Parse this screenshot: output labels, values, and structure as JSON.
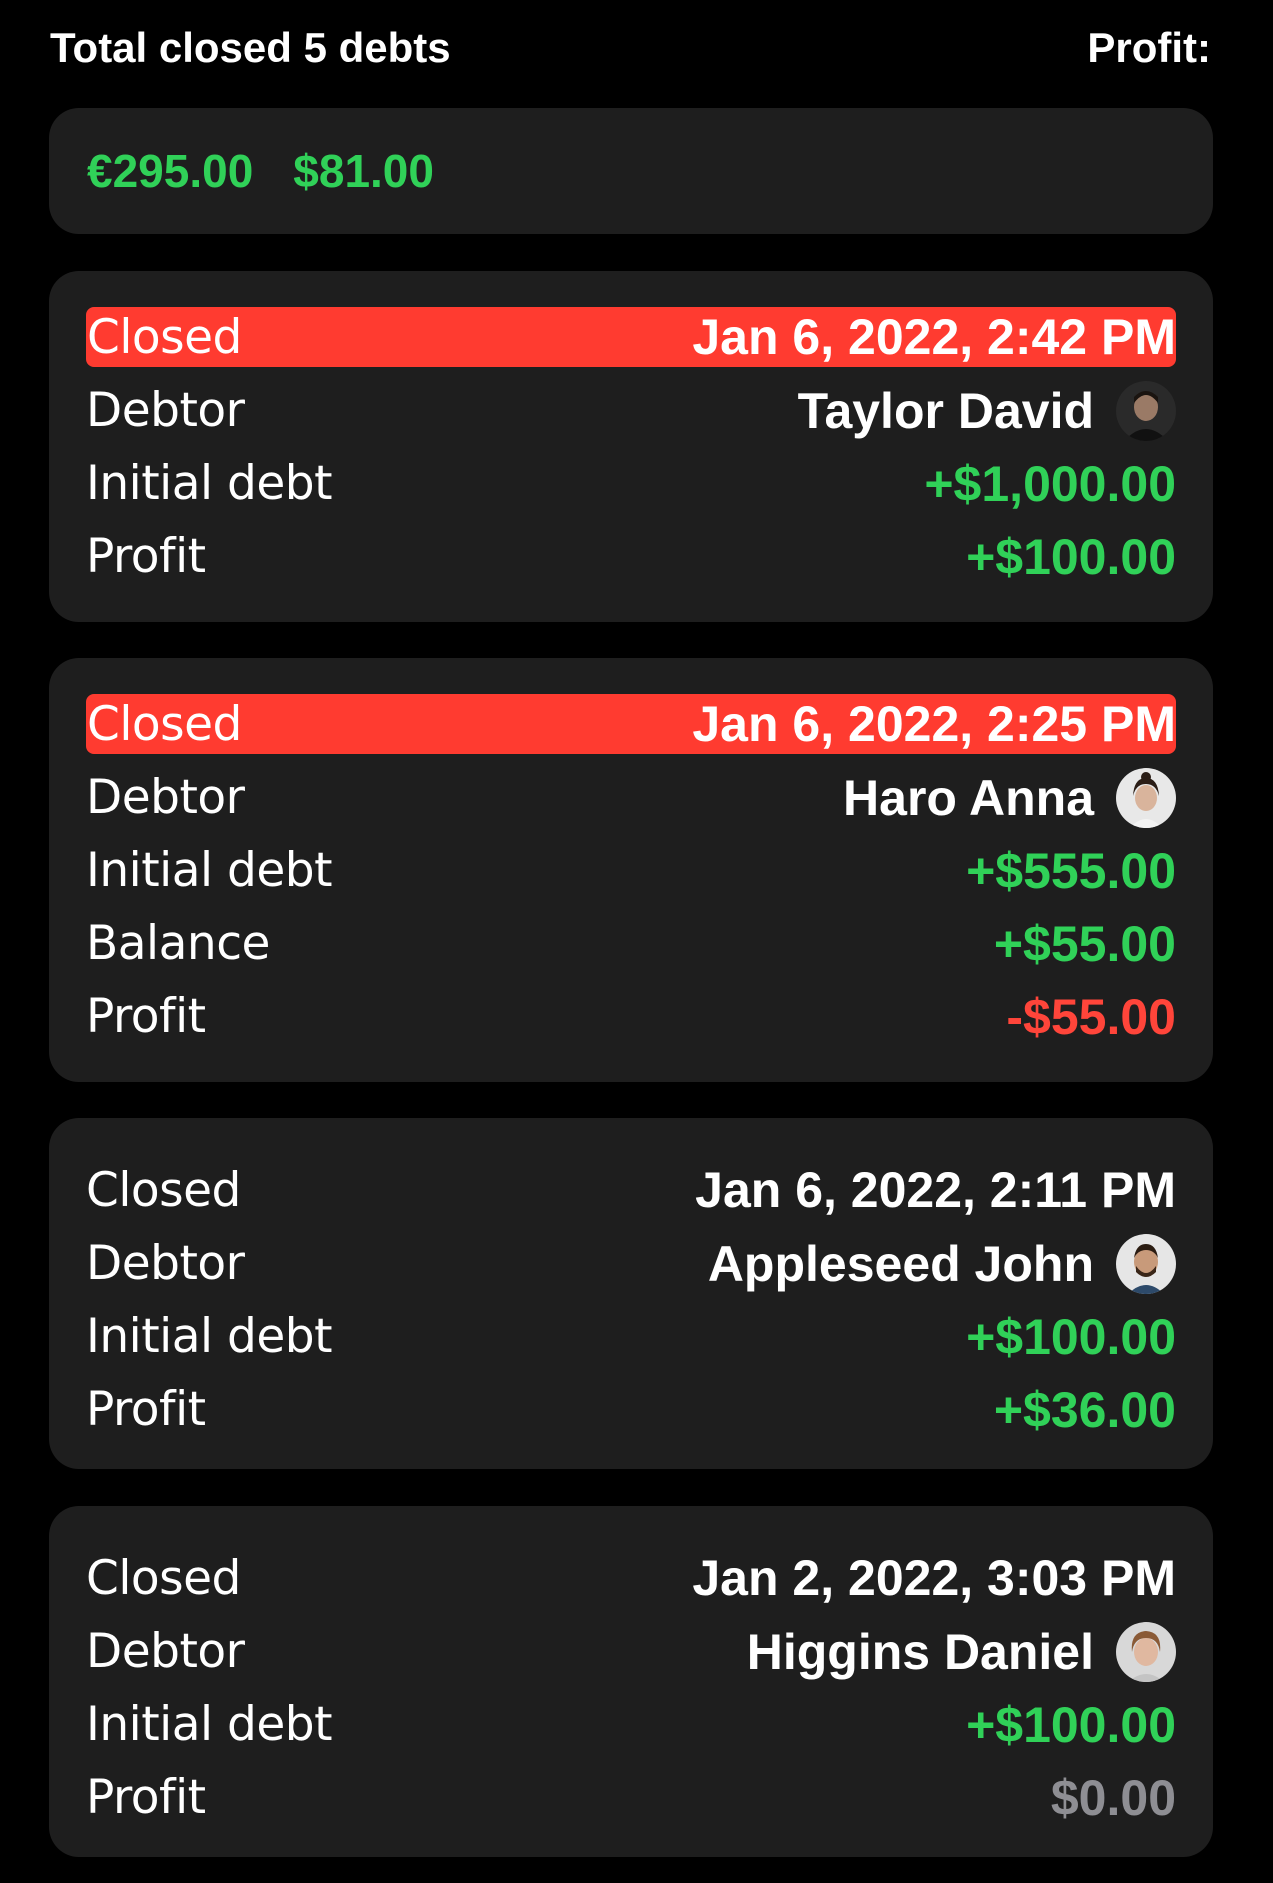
{
  "header": {
    "title": "Total closed 5 debts",
    "profit_label": "Profit:"
  },
  "summary": {
    "amounts": [
      "€295.00",
      "$81.00"
    ]
  },
  "colors": {
    "positive": "#30d158",
    "negative": "#ff453a",
    "neutral": "#8e8e93",
    "highlight": "#ff3b30",
    "card_bg": "#1e1e1e"
  },
  "debts": [
    {
      "closed_label": "Closed",
      "closed_date": "Jan 6, 2022, 2:42 PM",
      "highlighted": true,
      "debtor_label": "Debtor",
      "debtor_name": "Taylor David",
      "avatar_icon": "avatar-taylor-david",
      "initial_label": "Initial debt",
      "initial_value": "+$1,000.00",
      "profit_label": "Profit",
      "profit_value": "+$100.00"
    },
    {
      "closed_label": "Closed",
      "closed_date": "Jan 6, 2022, 2:25 PM",
      "highlighted": true,
      "debtor_label": "Debtor",
      "debtor_name": "Haro Anna",
      "avatar_icon": "avatar-haro-anna",
      "initial_label": "Initial debt",
      "initial_value": "+$555.00",
      "balance_label": "Balance",
      "balance_value": "+$55.00",
      "profit_label": "Profit",
      "profit_value": "-$55.00"
    },
    {
      "closed_label": "Closed",
      "closed_date": "Jan 6, 2022, 2:11 PM",
      "highlighted": false,
      "debtor_label": "Debtor",
      "debtor_name": "Appleseed John",
      "avatar_icon": "avatar-appleseed-john",
      "initial_label": "Initial debt",
      "initial_value": "+$100.00",
      "profit_label": "Profit",
      "profit_value": "+$36.00"
    },
    {
      "closed_label": "Closed",
      "closed_date": "Jan 2, 2022, 3:03 PM",
      "highlighted": false,
      "debtor_label": "Debtor",
      "debtor_name": "Higgins Daniel",
      "avatar_icon": "avatar-higgins-daniel",
      "initial_label": "Initial debt",
      "initial_value": "+$100.00",
      "profit_label": "Profit",
      "profit_value": "$0.00"
    }
  ]
}
